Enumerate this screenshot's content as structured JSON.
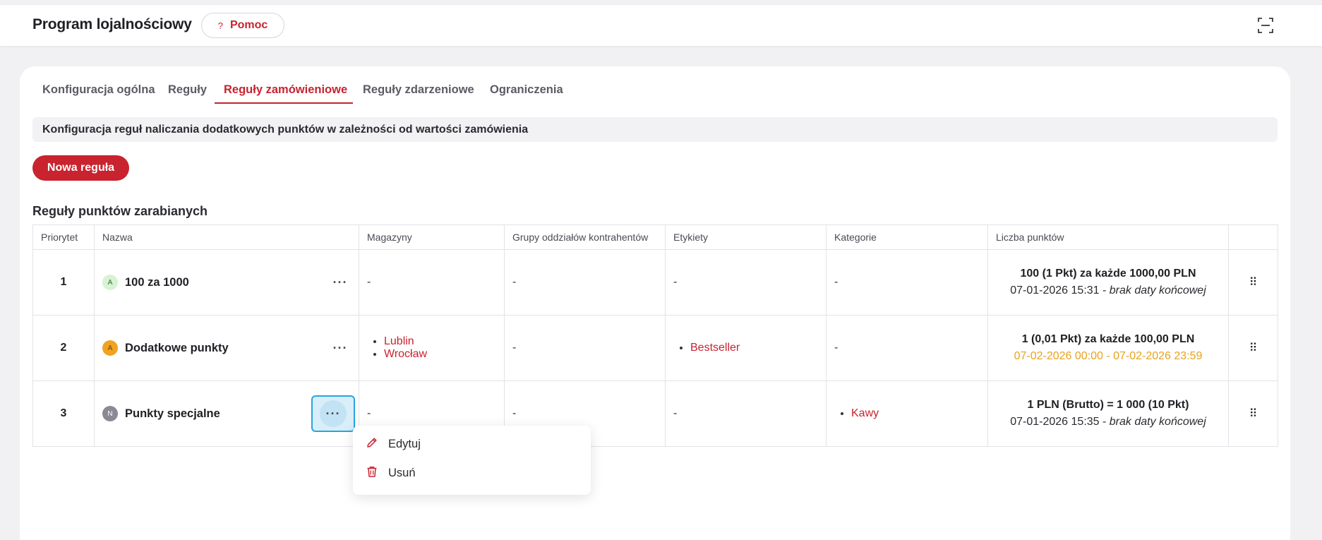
{
  "header": {
    "title": "Program lojalnościowy",
    "help_label": "Pomoc",
    "help_glyph": "?"
  },
  "tabs": [
    {
      "label": "Konfiguracja ogólna"
    },
    {
      "label": "Reguły"
    },
    {
      "label": "Reguły zamówieniowe"
    },
    {
      "label": "Reguły zdarzeniowe"
    },
    {
      "label": "Ograniczenia"
    }
  ],
  "active_tab": "Reguły zamówieniowe",
  "info_text": "Konfiguracja reguł naliczania dodatkowych punktów w zależności od wartości zamówienia",
  "new_rule_label": "Nowa reguła",
  "section_title": "Reguły punktów zarabianych",
  "table": {
    "columns": [
      "Priorytet",
      "Nazwa",
      "Magazyny",
      "Grupy oddziałów kontrahentów",
      "Etykiety",
      "Kategorie",
      "Liczba punktów",
      ""
    ],
    "rows": [
      {
        "priority": "1",
        "avatar": "A",
        "name": "100 za 1000",
        "warehouses": "-",
        "groups": "-",
        "labels": "-",
        "categories": "-",
        "points": "100 (1 Pkt) za każde 1000,00 PLN",
        "date_start": "07-01-2026 15:31 - ",
        "date_end": "brak daty końcowej"
      },
      {
        "priority": "2",
        "avatar": "A",
        "name": "Dodatkowe punkty",
        "warehouses": [
          "Lublin",
          "Wrocław"
        ],
        "groups": "-",
        "labels": [
          "Bestseller"
        ],
        "categories": "-",
        "points": "1 (0,01 Pkt) za każde 100,00 PLN",
        "date_range": "07-02-2026 00:00 - 07-02-2026 23:59"
      },
      {
        "priority": "3",
        "avatar": "N",
        "name": "Punkty specjalne",
        "warehouses": "-",
        "groups": "-",
        "labels": "-",
        "categories": [
          "Kawy"
        ],
        "points": "1 PLN (Brutto) = 1 000 (10 Pkt)",
        "date_start": "07-01-2026 15:35 - ",
        "date_end": "brak daty końcowej"
      }
    ]
  },
  "row_menu_glyph": "···",
  "drag_glyph": "⠿",
  "context_menu": {
    "edit_label": "Edytuj",
    "delete_label": "Usuń"
  },
  "colors": {
    "accent": "#c8232f",
    "warning": "#e8a21c",
    "focus": "#2aa3de"
  }
}
